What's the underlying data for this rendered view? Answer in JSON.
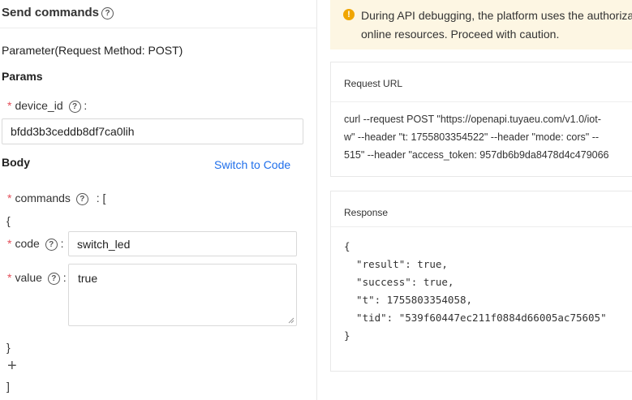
{
  "header": {
    "title": "Send commands"
  },
  "parameter": {
    "heading": "Parameter(Request Method: POST)"
  },
  "params": {
    "heading": "Params",
    "device_id": {
      "label": "device_id",
      "colon": ":",
      "value": "bfdd3b3ceddb8df7ca0lih"
    }
  },
  "body": {
    "heading": "Body",
    "switch_label": "Switch to Code",
    "commands": {
      "label": "commands",
      "suffix": ": ["
    },
    "open_brace": "{",
    "code": {
      "label": "code",
      "colon": ":",
      "value": "switch_led"
    },
    "value": {
      "label": "value",
      "colon": ":",
      "value": "true"
    },
    "close_brace": "}",
    "add": "+",
    "close_bracket": "]"
  },
  "notice": {
    "line1": "During API debugging, the platform uses the authoriza",
    "line2": "online resources. Proceed with caution."
  },
  "request_url": {
    "title": "Request URL",
    "lines": [
      "curl --request POST \"https://openapi.tuyaeu.com/v1.0/iot-",
      "w\" --header \"t: 1755803354522\" --header \"mode: cors\" --",
      "515\" --header \"access_token: 957db6b9da8478d4c479066"
    ]
  },
  "response": {
    "title": "Response",
    "json": "{\n  \"result\": true,\n  \"success\": true,\n  \"t\": 1755803354058,\n  \"tid\": \"539f60447ec211f0884d66005ac75605\"\n}"
  },
  "colors": {
    "link": "#1f6feb",
    "required": "#e34d59",
    "warning": "#f0a500",
    "notice_bg": "#fdf6e3"
  },
  "icons": [
    "question-circle-icon",
    "warning-icon",
    "plus-icon",
    "resize-grip-icon"
  ]
}
